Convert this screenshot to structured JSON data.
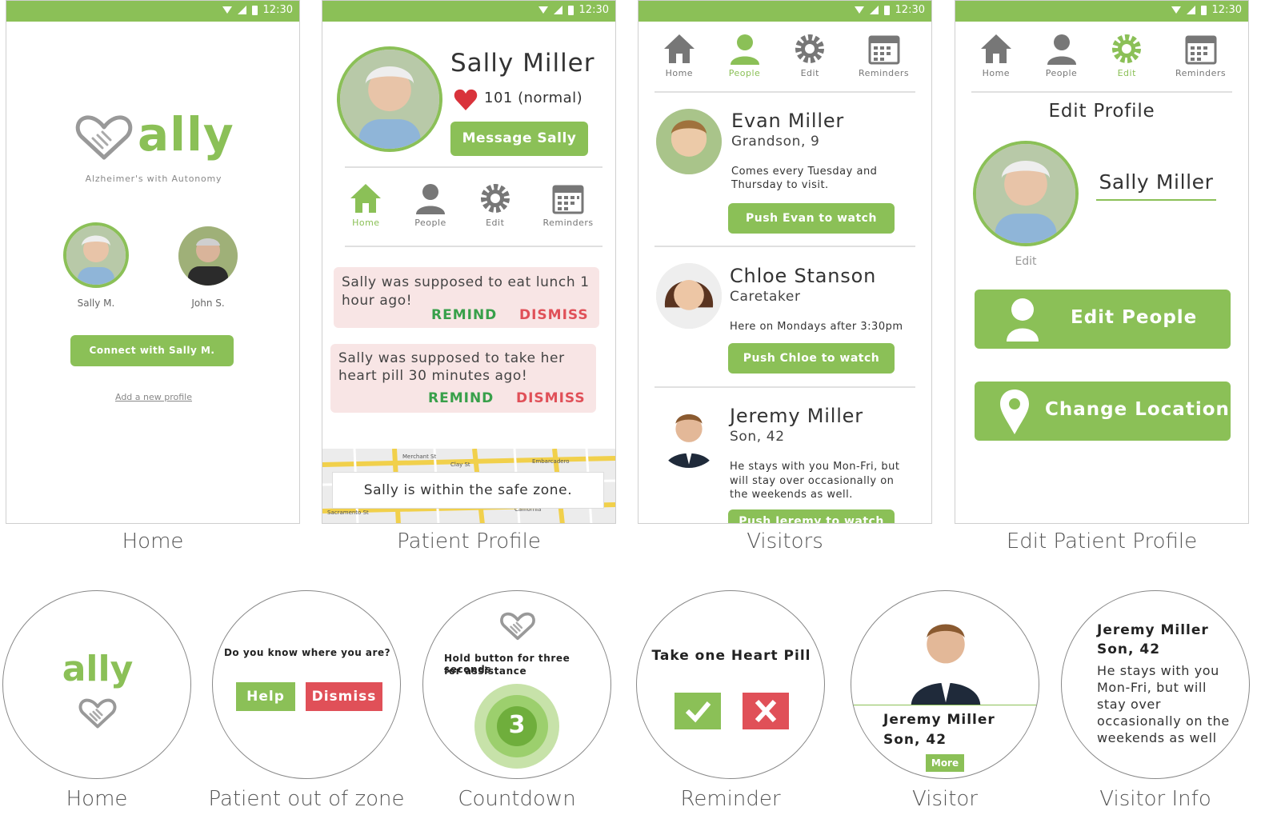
{
  "status_time": "12:30",
  "colors": {
    "brand": "#8bc057",
    "remind": "#38a04a",
    "dismiss": "#e05058",
    "alert_bg": "#f8e5e5"
  },
  "home": {
    "logo_text": "ally",
    "tagline": "Alzheimer's with Autonomy",
    "profiles": [
      {
        "label": "Sally M."
      },
      {
        "label": "John S."
      }
    ],
    "connect_label": "Connect with Sally M.",
    "add_link": "Add a new profile",
    "caption": "Home"
  },
  "profile": {
    "name": "Sally Miller",
    "heart_rate": "101 (normal)",
    "message_label": "Message Sally",
    "nav": [
      {
        "label": "Home",
        "icon": "home-icon"
      },
      {
        "label": "People",
        "icon": "person-icon"
      },
      {
        "label": "Edit",
        "icon": "gear-icon"
      },
      {
        "label": "Reminders",
        "icon": "calendar-icon"
      }
    ],
    "alerts": [
      {
        "text_line1": "Sally was supposed to eat lunch 1",
        "text_line2": "hour ago!",
        "remind": "REMIND",
        "dismiss": "DISMISS"
      },
      {
        "text_line1": "Sally was supposed to take her",
        "text_line2": "heart pill 30 minutes ago!",
        "remind": "REMIND",
        "dismiss": "DISMISS"
      }
    ],
    "map_streets": [
      "Merchant St",
      "Clay St",
      "Embarcadero",
      "Sacramento St",
      "California"
    ],
    "safe_zone": "Sally is within the safe zone.",
    "caption": "Patient Profile"
  },
  "visitors": {
    "nav": [
      {
        "label": "Home"
      },
      {
        "label": "People"
      },
      {
        "label": "Edit"
      },
      {
        "label": "Reminders"
      }
    ],
    "list": [
      {
        "name": "Evan Miller",
        "relation": "Grandson, 9",
        "note_line1": "Comes every Tuesday and",
        "note_line2": "Thursday to visit.",
        "note_line3": "",
        "button": "Push Evan to watch"
      },
      {
        "name": "Chloe Stanson",
        "relation": "Caretaker",
        "note_line1": "Here on Mondays after 3:30pm",
        "note_line2": "",
        "note_line3": "",
        "button": "Push Chloe to watch"
      },
      {
        "name": "Jeremy Miller",
        "relation": "Son, 42",
        "note_line1": "He stays with you Mon-Fri, but",
        "note_line2": "will stay over occasionally on",
        "note_line3": "the weekends as well.",
        "button": "Push Jeremy to watch"
      }
    ],
    "caption": "Visitors"
  },
  "edit": {
    "nav": [
      {
        "label": "Home"
      },
      {
        "label": "People"
      },
      {
        "label": "Edit"
      },
      {
        "label": "Reminders"
      }
    ],
    "title": "Edit Profile",
    "name_value": "Sally Miller",
    "photo_edit": "Edit",
    "edit_people": "Edit People",
    "change_location": "Change Location",
    "caption": "Edit Patient Profile"
  },
  "watch": {
    "home": {
      "logo_text": "ally",
      "caption": "Home"
    },
    "out_of_zone": {
      "question": "Do you know where you are?",
      "help": "Help",
      "dismiss": "Dismiss",
      "caption": "Patient out of zone"
    },
    "countdown": {
      "instruction_line1": "Hold button for three seconds",
      "instruction_line2": "for assistance",
      "count": "3",
      "caption": "Countdown"
    },
    "reminder": {
      "title": "Take one Heart Pill",
      "caption": "Reminder"
    },
    "visitor": {
      "name": "Jeremy Miller",
      "relation": "Son, 42",
      "more": "More",
      "caption": "Visitor"
    },
    "visitor_info": {
      "name": "Jeremy Miller",
      "relation": "Son, 42",
      "line1": "He stays with you",
      "line2": "Mon-Fri, but will",
      "line3": "stay over",
      "line4": "occasionally on the",
      "line5": "weekends as well",
      "caption": "Visitor Info"
    }
  }
}
